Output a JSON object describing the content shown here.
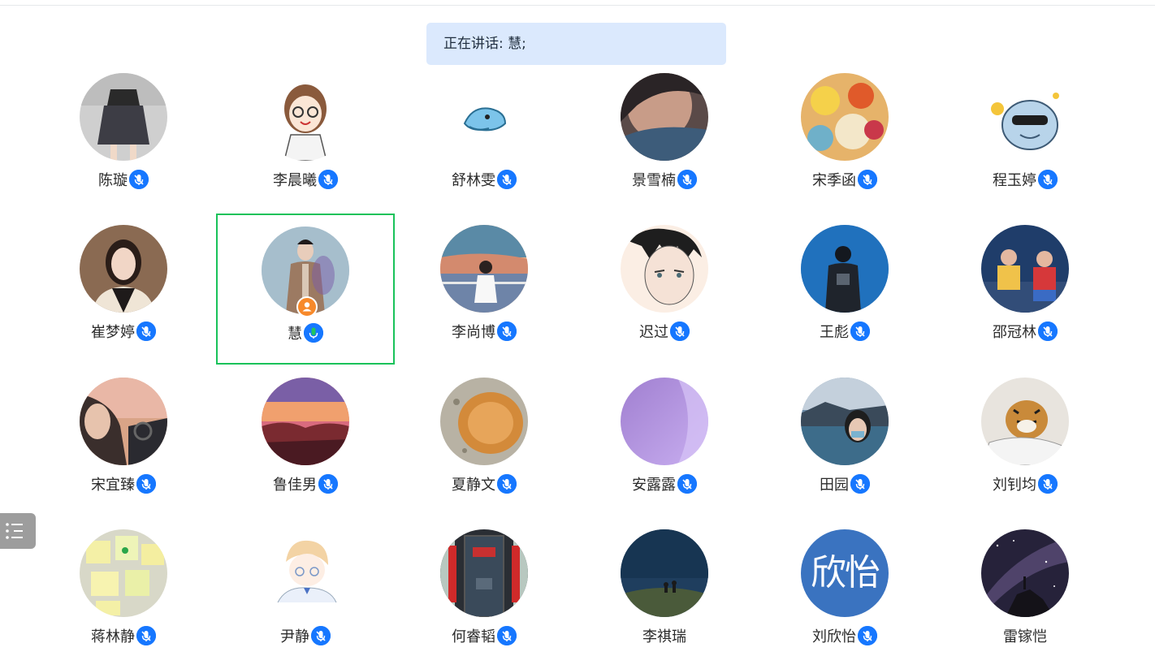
{
  "banner": {
    "speaking_text": "正在讲话: 慧;"
  },
  "participants": [
    {
      "name": "陈璇",
      "mic": "muted",
      "avatar": "photo-girl-skirt"
    },
    {
      "name": "李晨曦",
      "mic": "muted",
      "avatar": "cartoon-girl-glasses"
    },
    {
      "name": "舒林雯",
      "mic": "muted",
      "avatar": "cartoon-whale"
    },
    {
      "name": "景雪楠",
      "mic": "muted",
      "avatar": "photo-face-closeup"
    },
    {
      "name": "宋季函",
      "mic": "muted",
      "avatar": "photo-flowers"
    },
    {
      "name": "程玉婷",
      "mic": "muted",
      "avatar": "cartoon-cool-shark"
    },
    {
      "name": "崔梦婷",
      "mic": "muted",
      "avatar": "photo-woman-portrait"
    },
    {
      "name": "慧",
      "mic": "speaking",
      "avatar": "photo-man-coat",
      "host": true,
      "selected": true
    },
    {
      "name": "李尚博",
      "mic": "muted",
      "avatar": "photo-sunset-girl"
    },
    {
      "name": "迟过",
      "mic": "muted",
      "avatar": "sketch-boy-face"
    },
    {
      "name": "王彪",
      "mic": "muted",
      "avatar": "photo-aquarium"
    },
    {
      "name": "邵冠林",
      "mic": "muted",
      "avatar": "photo-kids-bench"
    },
    {
      "name": "宋宜臻",
      "mic": "muted",
      "avatar": "photo-car-selfie"
    },
    {
      "name": "鲁佳男",
      "mic": "muted",
      "avatar": "photo-pink-sky"
    },
    {
      "name": "夏静文",
      "mic": "muted",
      "avatar": "photo-cat"
    },
    {
      "name": "安露露",
      "mic": "muted",
      "avatar": "gradient-purple"
    },
    {
      "name": "田园",
      "mic": "muted",
      "avatar": "photo-lake-mask"
    },
    {
      "name": "刘钊均",
      "mic": "muted",
      "avatar": "photo-tiger-cat"
    },
    {
      "name": "蒋林静",
      "mic": "muted",
      "avatar": "photo-sticky-notes"
    },
    {
      "name": "尹静",
      "mic": "muted",
      "avatar": "cartoon-boy"
    },
    {
      "name": "何睿韬",
      "mic": "muted",
      "avatar": "photo-red-door"
    },
    {
      "name": "李祺瑞",
      "mic": "off",
      "avatar": "photo-night-sky-people"
    },
    {
      "name": "刘欣怡",
      "mic": "muted",
      "avatar": "text-avatar",
      "avatar_text": "欣怡"
    },
    {
      "name": "雷镓恺",
      "mic": "off",
      "avatar": "photo-milky-way"
    }
  ],
  "icons": {
    "mic_muted": "microphone-muted-icon",
    "mic_speaking": "microphone-active-icon",
    "host": "host-person-icon",
    "side_toggle": "list-menu-icon"
  },
  "colors": {
    "banner_bg": "#dbe9fd",
    "mic_badge": "#1677ff",
    "speaking_mic": "#22c55e",
    "selected_border": "#19c25a",
    "host_badge": "#f7892b",
    "text_avatar_bg": "#3a73c0"
  }
}
